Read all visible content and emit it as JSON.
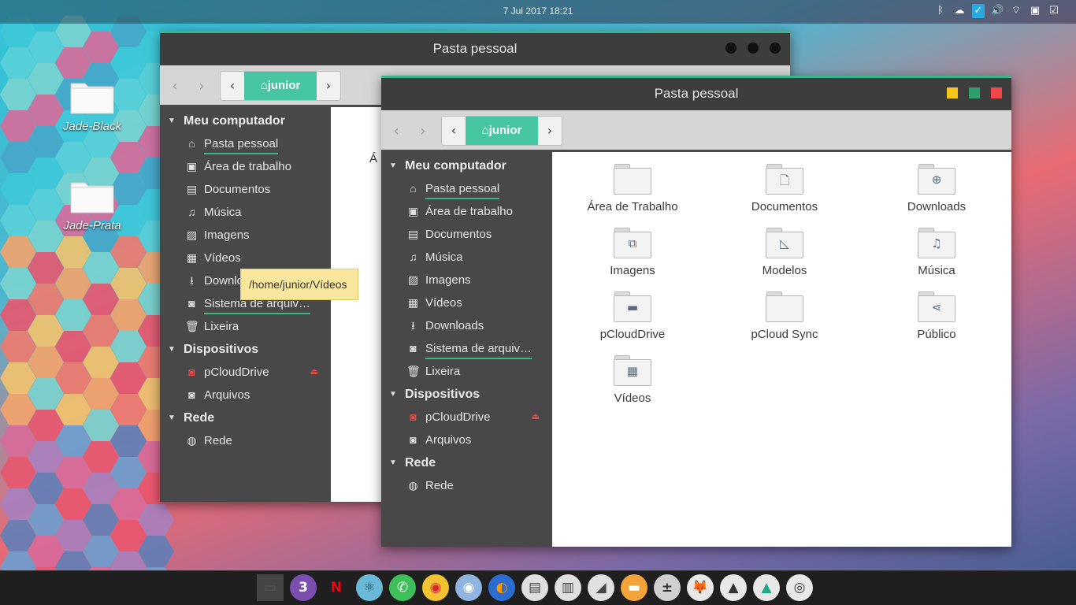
{
  "top_panel": {
    "clock": "7 Jul 2017 18:21",
    "tray_icons": [
      "bluetooth-icon",
      "cloud-sync-icon",
      "check-app-icon",
      "volume-icon",
      "wifi-icon",
      "monitor-icon",
      "clipboard-icon"
    ]
  },
  "desktop": {
    "icons": [
      {
        "label": "Jade-Black"
      },
      {
        "label": "Jade-Prata"
      }
    ]
  },
  "back_window": {
    "title": "Pasta pessoal",
    "crumb": {
      "current": "junior"
    },
    "sidebar": {
      "sections": [
        {
          "label": "Meu computador",
          "items": [
            "Pasta pessoal",
            "Área de trabalho",
            "Documentos",
            "Música",
            "Imagens",
            "Vídeos",
            "Downloads",
            "Sistema de arquiv…",
            "Lixeira"
          ]
        },
        {
          "label": "Dispositivos",
          "items": [
            "pCloudDrive",
            "Arquivos"
          ]
        },
        {
          "label": "Rede",
          "items": [
            "Rede"
          ]
        }
      ]
    },
    "content_partial": "Á"
  },
  "tooltip": "/home/junior/Vídeos",
  "front_window": {
    "title": "Pasta pessoal",
    "crumb": {
      "current": "junior"
    },
    "sidebar": {
      "sections": [
        {
          "label": "Meu computador",
          "items": [
            "Pasta pessoal",
            "Área de trabalho",
            "Documentos",
            "Música",
            "Imagens",
            "Vídeos",
            "Downloads",
            "Sistema de arquiv…",
            "Lixeira"
          ]
        },
        {
          "label": "Dispositivos",
          "items": [
            "pCloudDrive",
            "Arquivos"
          ]
        },
        {
          "label": "Rede",
          "items": [
            "Rede"
          ]
        }
      ]
    },
    "folders": [
      {
        "name": "Área de Trabalho",
        "icon": "desktop-folder-icon"
      },
      {
        "name": "Documentos",
        "icon": "documents-folder-icon"
      },
      {
        "name": "Downloads",
        "icon": "downloads-folder-icon"
      },
      {
        "name": "Imagens",
        "icon": "images-folder-icon"
      },
      {
        "name": "Modelos",
        "icon": "templates-folder-icon"
      },
      {
        "name": "Música",
        "icon": "music-folder-icon"
      },
      {
        "name": "pCloudDrive",
        "icon": "drive-folder-icon"
      },
      {
        "name": "pCloud Sync",
        "icon": "sync-folder-icon"
      },
      {
        "name": "Público",
        "icon": "public-folder-icon"
      },
      {
        "name": "Vídeos",
        "icon": "videos-folder-icon"
      }
    ],
    "controls": {
      "minimize_color": "#f5c518",
      "maximize_color": "#2e9e6e",
      "close_color": "#f04848"
    }
  },
  "dock": {
    "apps": [
      "files-icon",
      "three-icon",
      "netflix-icon",
      "atom-icon",
      "phone-icon",
      "chrome-icon",
      "chromium-icon",
      "firefox-icon",
      "notes-icon",
      "book-icon",
      "eraser-icon",
      "folder-icon",
      "calculator-icon",
      "gimp-icon",
      "inkscape-icon",
      "drive-icon",
      "aperture-icon"
    ]
  }
}
